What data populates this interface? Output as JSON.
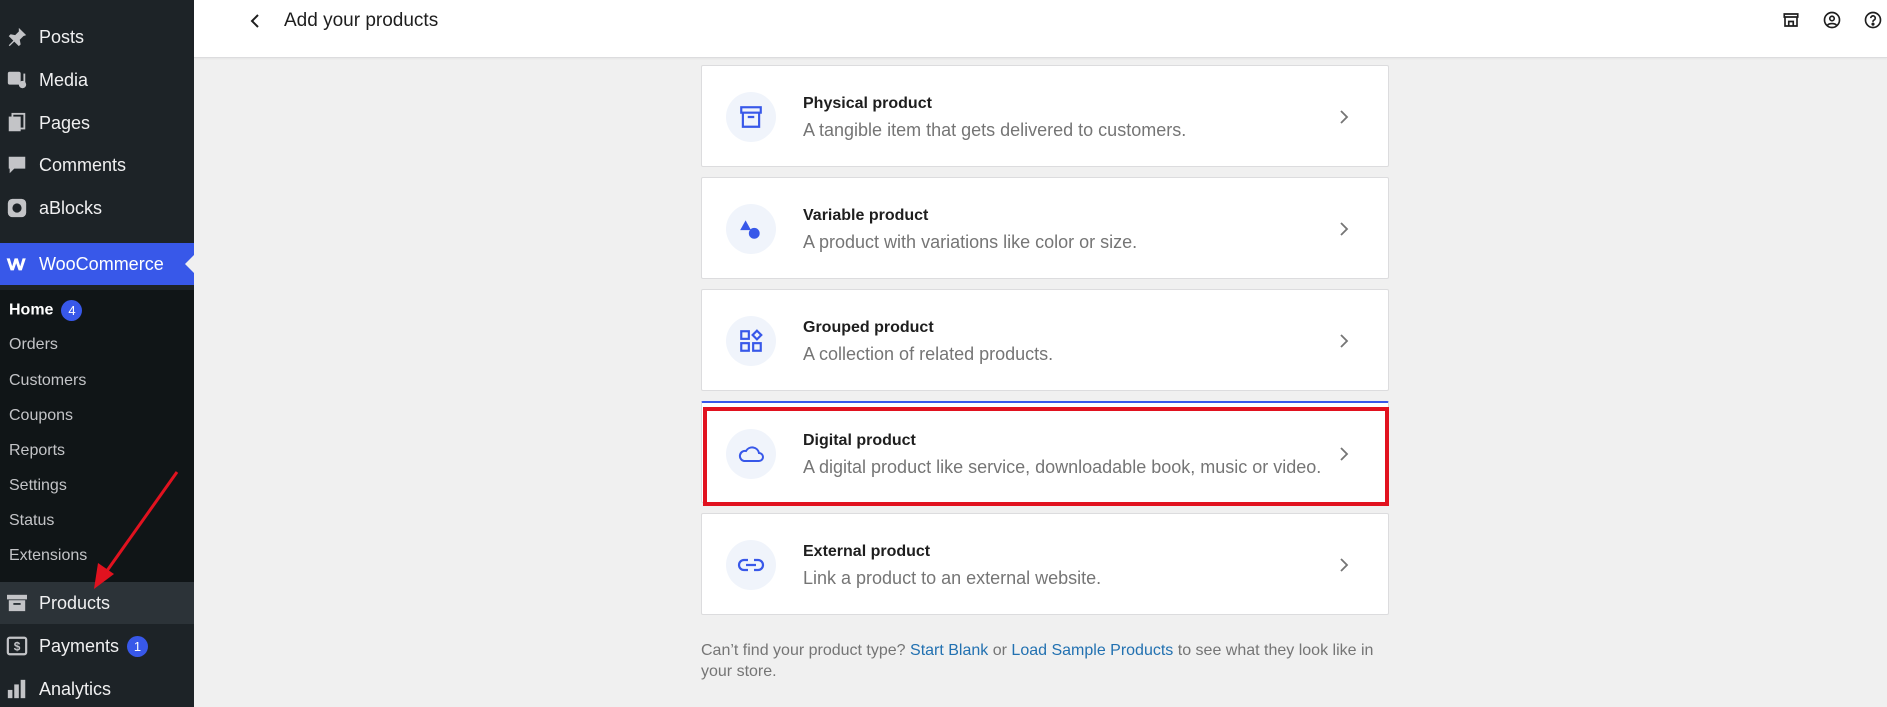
{
  "sidebar": {
    "menu": [
      {
        "label": "Posts",
        "icon": "pin-icon"
      },
      {
        "label": "Media",
        "icon": "media-icon"
      },
      {
        "label": "Pages",
        "icon": "pages-icon"
      },
      {
        "label": "Comments",
        "icon": "comment-icon"
      },
      {
        "label": "aBlocks",
        "icon": "ablocks-icon"
      },
      {
        "label": "WooCommerce",
        "icon": "woo-icon"
      }
    ],
    "submenu": [
      {
        "label": "Home",
        "badge": "4"
      },
      {
        "label": "Orders"
      },
      {
        "label": "Customers"
      },
      {
        "label": "Coupons"
      },
      {
        "label": "Reports"
      },
      {
        "label": "Settings"
      },
      {
        "label": "Status"
      },
      {
        "label": "Extensions"
      }
    ],
    "bottom": [
      {
        "label": "Products",
        "icon": "archive-icon"
      },
      {
        "label": "Payments",
        "icon": "dollar-icon",
        "badge": "1"
      },
      {
        "label": "Analytics",
        "icon": "chart-icon"
      }
    ]
  },
  "header": {
    "title": "Add your products"
  },
  "cards": [
    {
      "title": "Physical product",
      "desc": "A tangible item that gets delivered to customers."
    },
    {
      "title": "Variable product",
      "desc": "A product with variations like color or size."
    },
    {
      "title": "Grouped product",
      "desc": "A collection of related products."
    },
    {
      "title": "Digital product",
      "desc": "A digital product like service, downloadable book, music or video."
    },
    {
      "title": "External product",
      "desc": "Link a product to an external website."
    }
  ],
  "footer": {
    "prefix": "Can’t find your product type?",
    "start_blank": "Start Blank",
    "or": "or",
    "load_sample": "Load Sample Products",
    "suffix": "to see what they look like in your store."
  },
  "colors": {
    "accent": "#3858e9",
    "sidebar_bg": "#1d2327",
    "highlight": "#e1121f",
    "link": "#2271b1"
  }
}
